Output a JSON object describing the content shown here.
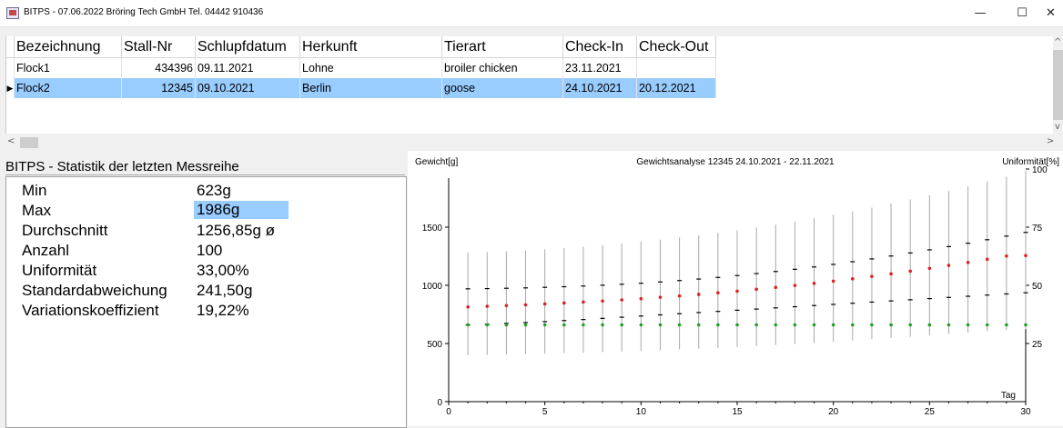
{
  "window": {
    "title": "BITPS - 07.06.2022 Bröring Tech GmbH  Tel. 04442 910436",
    "buttons": {
      "minimize": "—",
      "maximize": "☐",
      "close": "✕"
    }
  },
  "grid": {
    "columns": [
      "Bezeichnung",
      "Stall-Nr",
      "Schlupfdatum",
      "Herkunft",
      "Tierart",
      "Check-In",
      "Check-Out"
    ],
    "rows": [
      {
        "indicator": "",
        "bezeichnung": "Flock1",
        "stall": "434396",
        "schlupf": "09.11.2021",
        "herkunft": "Lohne",
        "tierart": "broiler chicken",
        "checkin": "23.11.2021",
        "checkout": ""
      },
      {
        "indicator": "▶",
        "bezeichnung": "Flock2",
        "stall": "12345",
        "schlupf": "09.10.2021",
        "herkunft": "Berlin",
        "tierart": "goose",
        "checkin": "24.10.2021",
        "checkout": "20.12.2021"
      }
    ]
  },
  "scroll": {
    "up": "^",
    "down": "v",
    "left": "<",
    "right": ">"
  },
  "stats": {
    "header": "BITPS - Statistik der letzten Messreihe",
    "rows": [
      {
        "label": "Min",
        "value": "623g"
      },
      {
        "label": "Max",
        "value": "1986g"
      },
      {
        "label": "Durchschnitt",
        "value": "1256,85g ø"
      },
      {
        "label": "Anzahl",
        "value": "100"
      },
      {
        "label": "Uniformität",
        "value": "33,00%"
      },
      {
        "label": "Standardabweichung",
        "value": "241,50g"
      },
      {
        "label": "Variationskoeffizient",
        "value": "19,22%"
      }
    ]
  },
  "chart_data": {
    "type": "scatter",
    "title": "Gewichtsanalyse 12345 24.10.2021 - 22.11.2021",
    "ylabel": "Gewicht[g]",
    "y2label": "Uniformität[%]",
    "xlabel": "Tag",
    "xlim": [
      0,
      30
    ],
    "ylim": [
      0,
      2000
    ],
    "y2lim": [
      0,
      100
    ],
    "xticks": [
      0,
      5,
      10,
      15,
      20,
      25,
      30
    ],
    "yticks": [
      0,
      500,
      1000,
      1500
    ],
    "y2ticks": [
      25,
      50,
      75,
      100
    ],
    "colors": {
      "mean": "#e02020",
      "uniformity": "#20a020",
      "range": "#a8a8a8",
      "sd": "#000000"
    },
    "x": [
      1,
      2,
      3,
      4,
      5,
      6,
      7,
      8,
      9,
      10,
      11,
      12,
      13,
      14,
      15,
      16,
      17,
      18,
      19,
      20,
      21,
      22,
      23,
      24,
      25,
      26,
      27,
      28,
      29,
      30
    ],
    "series": [
      {
        "values": [
          814,
          820,
          826,
          832,
          840,
          848,
          856,
          865,
          875,
          885,
          897,
          909,
          922,
          936,
          950,
          966,
          982,
          999,
          1017,
          1036,
          1056,
          1077,
          1099,
          1122,
          1146,
          1171,
          1197,
          1224,
          1252,
          1256
        ]
      },
      {
        "values": [
          33,
          33,
          33,
          33,
          33,
          33,
          33,
          33,
          33,
          33,
          33,
          33,
          33,
          33,
          33,
          33,
          33,
          33,
          33,
          33,
          33,
          33,
          33,
          33,
          33,
          33,
          33,
          33,
          33,
          33
        ]
      }
    ],
    "sd_upper": [
      970,
      972,
      975,
      978,
      983,
      988,
      994,
      1001,
      1009,
      1018,
      1029,
      1041,
      1054,
      1068,
      1084,
      1101,
      1119,
      1138,
      1158,
      1180,
      1203,
      1227,
      1252,
      1278,
      1305,
      1333,
      1362,
      1392,
      1423,
      1455
    ],
    "sd_lower": [
      660,
      666,
      673,
      680,
      688,
      697,
      706,
      716,
      726,
      736,
      746,
      756,
      766,
      776,
      786,
      796,
      806,
      816,
      826,
      836,
      846,
      856,
      866,
      876,
      886,
      896,
      906,
      916,
      926,
      936
    ],
    "range_max": [
      1280,
      1285,
      1292,
      1300,
      1310,
      1320,
      1332,
      1345,
      1360,
      1376,
      1393,
      1411,
      1430,
      1451,
      1473,
      1497,
      1522,
      1548,
      1576,
      1606,
      1637,
      1669,
      1703,
      1738,
      1774,
      1812,
      1851,
      1892,
      1934,
      1986
    ],
    "range_min": [
      400,
      402,
      405,
      408,
      412,
      416,
      420,
      425,
      430,
      436,
      442,
      448,
      455,
      462,
      470,
      478,
      487,
      496,
      505,
      515,
      525,
      536,
      547,
      558,
      570,
      582,
      594,
      606,
      614,
      623
    ]
  }
}
